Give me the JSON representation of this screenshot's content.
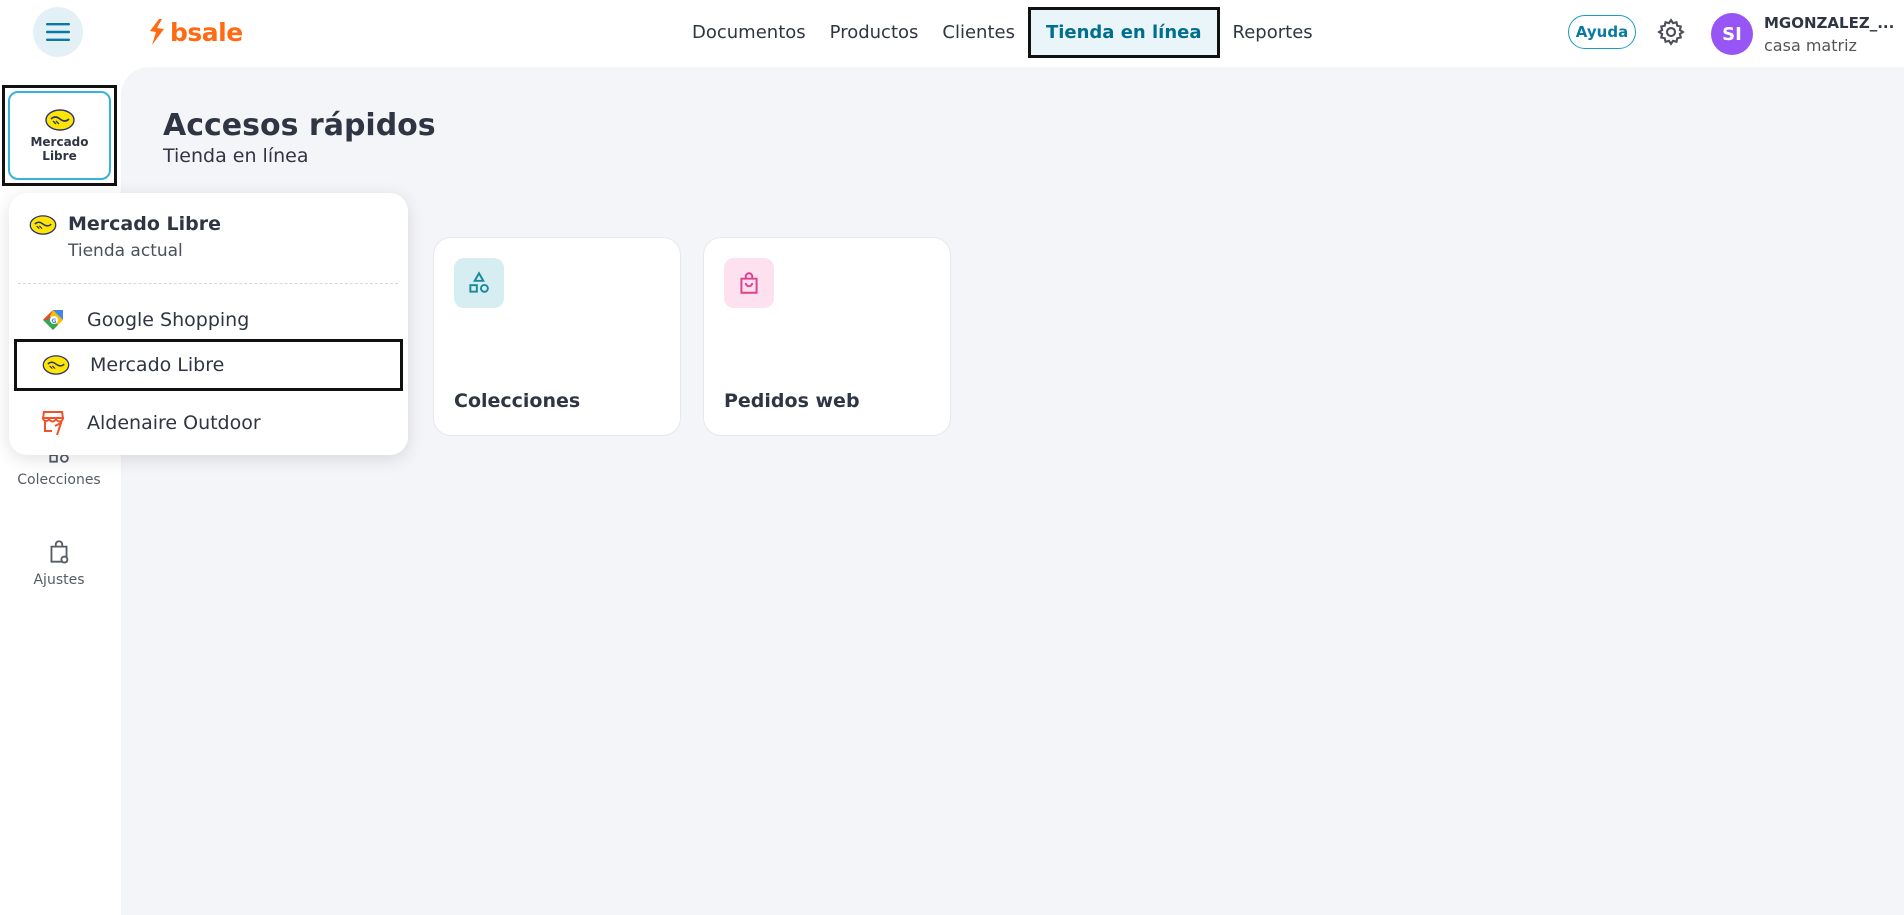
{
  "header": {
    "logo_text": "bsale",
    "nav": [
      {
        "label": "Documentos"
      },
      {
        "label": "Productos"
      },
      {
        "label": "Clientes"
      },
      {
        "label": "Tienda en línea",
        "active": true
      },
      {
        "label": "Reportes"
      }
    ],
    "help_label": "Ayuda",
    "user": {
      "initials": "SI",
      "name": "MGONZALEZ_...",
      "branch": "casa matriz"
    }
  },
  "sidebar": {
    "store_switch_label": "Mercado Libre",
    "items": [
      {
        "label": "Colecciones",
        "icon": "shapes-icon"
      },
      {
        "label": "Ajustes",
        "icon": "bag-settings-icon"
      }
    ]
  },
  "main": {
    "title": "Accesos rápidos",
    "subtitle": "Tienda en línea",
    "cards": [
      {
        "label": "Colecciones",
        "icon": "shapes-icon",
        "icon_bg": "#d6eef2",
        "icon_color": "#1a8a9c"
      },
      {
        "label": "Pedidos web",
        "icon": "shopping-bag-icon",
        "icon_bg": "#fde1ef",
        "icon_color": "#e0418f"
      }
    ]
  },
  "store_dropdown": {
    "current": {
      "title": "Mercado Libre",
      "subtitle": "Tienda actual"
    },
    "items": [
      {
        "label": "Google Shopping",
        "icon": "google-shopping-icon"
      },
      {
        "label": "Mercado Libre",
        "icon": "mercado-libre-icon",
        "selected": true
      },
      {
        "label": "Aldenaire Outdoor",
        "icon": "storefront-icon"
      }
    ]
  },
  "colors": {
    "brand": "#ff6a13",
    "accent": "#006e8f",
    "avatar": "#9855f5",
    "background": "#f4f5f8"
  }
}
